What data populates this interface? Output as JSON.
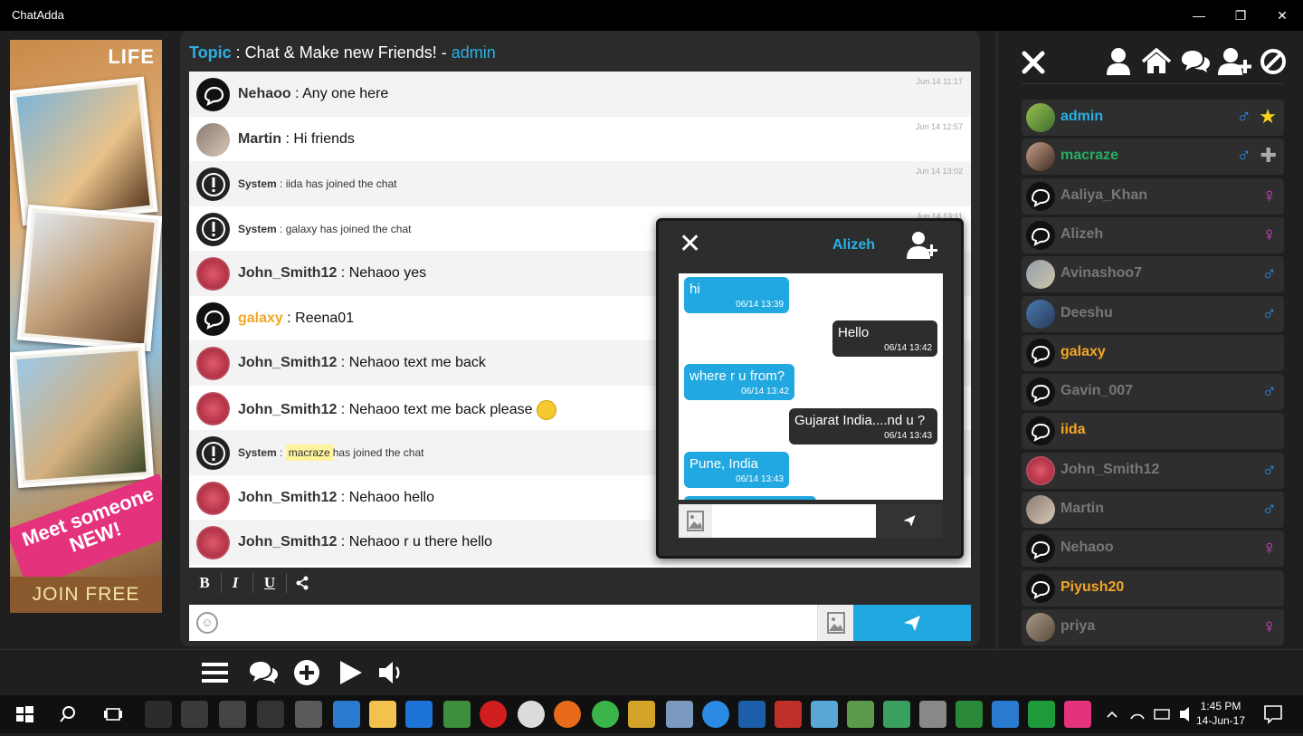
{
  "window": {
    "title": "ChatAdda",
    "minimize": "—",
    "maximize": "❐",
    "close": "✕"
  },
  "ad": {
    "logo": "LIFE",
    "headline": "Meet someone NEW!",
    "cta": "JOIN FREE"
  },
  "topic": {
    "label": "Topic",
    "text": " : Chat & Make new Friends! - ",
    "owner": "admin"
  },
  "messages": [
    {
      "user": "Nehaoo",
      "text": " : Any one here",
      "time": "Jun 14 11:17"
    },
    {
      "user": "Martin",
      "text": " : Hi friends",
      "time": "Jun 14 12:57"
    },
    {
      "user": "System",
      "text": " : iida has joined the chat",
      "time": "Jun 14 13:02"
    },
    {
      "user": "System",
      "text": " : galaxy has joined the chat",
      "time": "Jun 14 13:11"
    },
    {
      "user": "John_Smith12",
      "text": " : Nehaoo yes",
      "time": ""
    },
    {
      "user": "galaxy",
      "text": " : Reena01",
      "time": ""
    },
    {
      "user": "John_Smith12",
      "text": " : Nehaoo text me back",
      "time": ""
    },
    {
      "user": "John_Smith12",
      "text": " : Nehaoo text me back please",
      "time": ""
    },
    {
      "user": "System",
      "text": " : ",
      "highlight": "macraze",
      "rest": "has joined the chat",
      "time": ""
    },
    {
      "user": "John_Smith12",
      "text": " : Nehaoo hello",
      "time": ""
    },
    {
      "user": "John_Smith12",
      "text": " : Nehaoo r u there hello",
      "time": ""
    }
  ],
  "toolbar": {
    "bold": "B",
    "italic": "I",
    "underline": "U"
  },
  "input": {
    "placeholder": ""
  },
  "private_chat": {
    "user": "Alizeh",
    "messages": [
      {
        "dir": "in",
        "text": "hi",
        "time": "06/14 13:39"
      },
      {
        "dir": "out",
        "text": "Hello",
        "time": "06/14 13:42"
      },
      {
        "dir": "in",
        "text": "where r u from?",
        "time": "06/14 13:42"
      },
      {
        "dir": "out",
        "text": "Gujarat India....nd u ?",
        "time": "06/14 13:43"
      },
      {
        "dir": "in",
        "text": "Pune, India",
        "time": "06/14 13:43"
      }
    ]
  },
  "users": [
    {
      "name": "admin",
      "color": "#2ab0e4",
      "gender": "♂",
      "gcolor": "#2a8ae4",
      "badge": "★"
    },
    {
      "name": "macraze",
      "color": "#27ae60",
      "gender": "♂",
      "gcolor": "#2a8ae4",
      "badge": "✚"
    },
    {
      "name": "Aaliya_Khan",
      "color": "#777777",
      "gender": "♀",
      "gcolor": "#e23fe0"
    },
    {
      "name": "Alizeh",
      "color": "#777777",
      "gender": "♀",
      "gcolor": "#e23fe0"
    },
    {
      "name": "Avinashoo7",
      "color": "#777777",
      "gender": "♂",
      "gcolor": "#2a8ae4"
    },
    {
      "name": "Deeshu",
      "color": "#777777",
      "gender": "♂",
      "gcolor": "#2a8ae4"
    },
    {
      "name": "galaxy",
      "color": "#f5a623",
      "gender": "",
      "gcolor": "#2a8ae4"
    },
    {
      "name": "Gavin_007",
      "color": "#777777",
      "gender": "♂",
      "gcolor": "#2a8ae4"
    },
    {
      "name": "iida",
      "color": "#f5a623",
      "gender": "",
      "gcolor": "#2a8ae4"
    },
    {
      "name": "John_Smith12",
      "color": "#777777",
      "gender": "♂",
      "gcolor": "#2a8ae4"
    },
    {
      "name": "Martin",
      "color": "#777777",
      "gender": "♂",
      "gcolor": "#2a8ae4"
    },
    {
      "name": "Nehaoo",
      "color": "#777777",
      "gender": "♀",
      "gcolor": "#e23fe0"
    },
    {
      "name": "Piyush20",
      "color": "#f5a623",
      "gender": "",
      "gcolor": "#2a8ae4"
    },
    {
      "name": "priya",
      "color": "#777777",
      "gender": "♀",
      "gcolor": "#e23fe0"
    }
  ],
  "clock": {
    "time": "1:45 PM",
    "date": "14-Jun-17"
  }
}
